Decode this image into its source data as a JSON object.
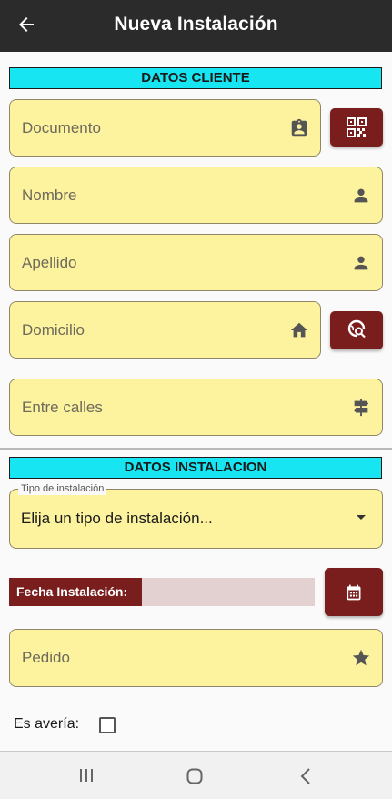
{
  "appbar": {
    "title": "Nueva Instalación",
    "back_icon": "arrow-back-icon"
  },
  "client_section": {
    "header": "DATOS CLIENTE",
    "fields": {
      "documento": {
        "label": "Documento",
        "icon": "contact-card-icon"
      },
      "nombre": {
        "label": "Nombre",
        "icon": "person-icon"
      },
      "apellido": {
        "label": "Apellido",
        "icon": "person-icon"
      },
      "domicilio": {
        "label": "Domicilio",
        "icon": "home-icon"
      },
      "entre_calles": {
        "label": "Entre calles",
        "icon": "signpost-icon"
      }
    },
    "buttons": {
      "qr": "qr-code-icon",
      "location": "location-search-icon"
    }
  },
  "install_section": {
    "header": "DATOS INSTALACION",
    "tipo": {
      "floating_label": "Tipo de instalación",
      "value": "Elija un tipo de instalación..."
    },
    "fecha": {
      "label": "Fecha Instalación:",
      "value": "",
      "button_icon": "calendar-icon"
    },
    "pedido": {
      "label": "Pedido",
      "icon": "star-icon"
    },
    "averia": {
      "label": "Es avería:",
      "checked": false
    }
  },
  "colors": {
    "appbar": "#2b2b2b",
    "header_bg": "#18e5f2",
    "field_bg": "#fdf39f",
    "accent": "#7a1d1d",
    "date_bg": "#e3d0d0"
  }
}
